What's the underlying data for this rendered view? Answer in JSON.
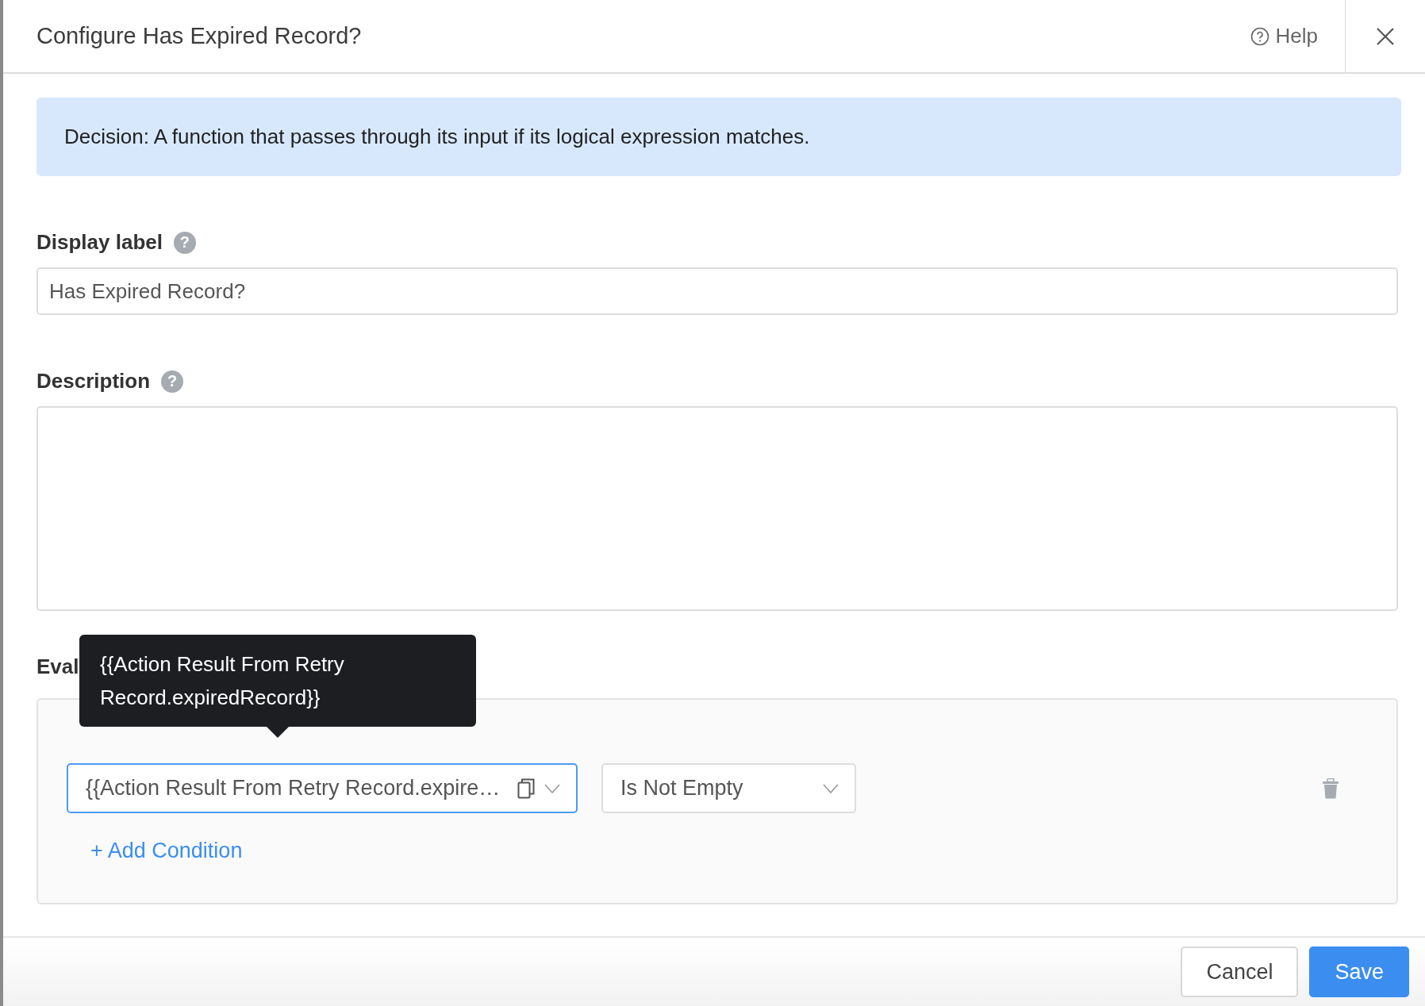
{
  "dialog": {
    "title": "Configure Has Expired Record?",
    "help_label": "Help"
  },
  "info_banner": {
    "text": "Decision: A function that passes through its input if its logical expression matches."
  },
  "fields": [
    {
      "label": "Display label",
      "help_icon_text": "?",
      "kind": "input",
      "value": "Has Expired Record?"
    },
    {
      "label": "Description",
      "help_icon_text": "?",
      "kind": "textarea"
    }
  ],
  "evaluation": {
    "label": "Eval",
    "tooltip": "{{Action Result From Retry Record.expiredRecord}}",
    "conditions": [
      {
        "value": "{{Action Result From Retry Record.expire…",
        "focused": true,
        "operator": "Is Not Empty"
      }
    ],
    "add_condition": "+ Add Condition"
  },
  "footer": {
    "buttons": [
      {
        "label": "Cancel",
        "kind": "secondary"
      },
      {
        "label": "Save",
        "kind": "primary"
      }
    ]
  }
}
